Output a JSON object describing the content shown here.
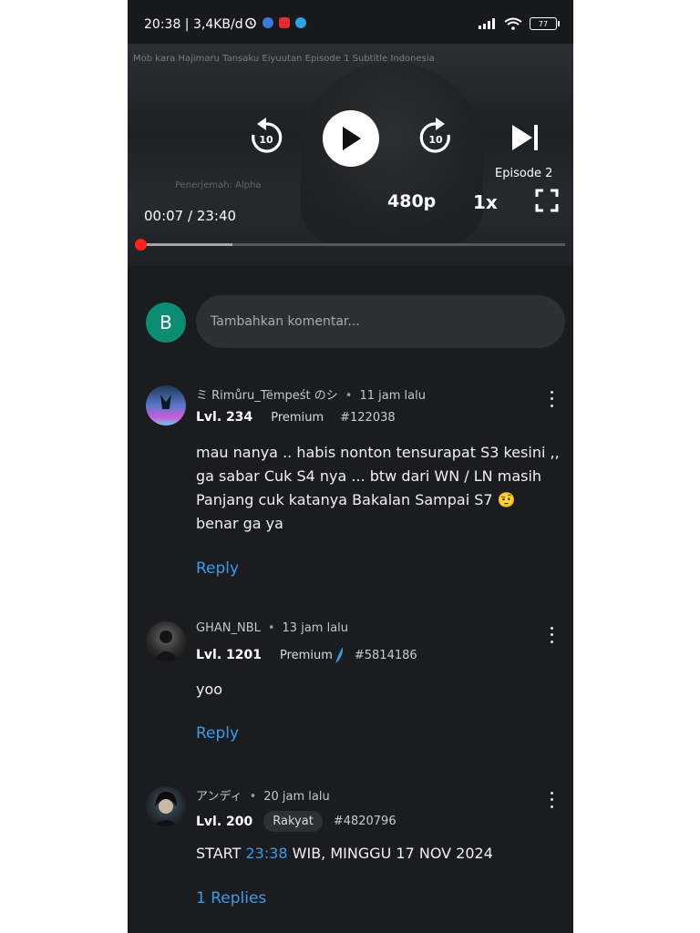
{
  "status_bar": {
    "time": "20:38 | 3,4KB/d",
    "battery": "77"
  },
  "video": {
    "overlay_title": "Mob kara Hajimaru Tansaku Eiyuutan Episode 1 Subtitle Indonesia",
    "watermark": "Penerjemah: Alpha",
    "episode_label": "Episode 2",
    "timecode": "00:07 / 23:40",
    "quality": "480p",
    "speed": "1x",
    "rewind_seconds": "10",
    "forward_seconds": "10",
    "progress_fraction": 0.0049,
    "buffered_fraction": 0.22
  },
  "comment_box": {
    "avatar_letter": "B",
    "placeholder": "Tambahkan komentar..."
  },
  "comments": [
    {
      "username": "ミ Rimůru_Tëmpeśt のシ",
      "time": "11 jam lalu",
      "level": "Lvl. 234",
      "rank": "Premium",
      "id": "#122038",
      "text": "mau nanya .. habis nonton tensurapat S3 kesini ,, ga sabar Cuk S4 nya ... btw dari WN / LN masih Panjang cuk katanya Bakalan Sampai S7 🤨 benar ga ya",
      "action": "Reply"
    },
    {
      "username": "GHAN_NBL",
      "time": "13 jam lalu",
      "level": "Lvl. 1201",
      "rank": "Premium",
      "id": "#5814186",
      "text": "yoo",
      "action": "Reply"
    },
    {
      "username": "アンディ",
      "time": "20 jam lalu",
      "level": "Lvl. 200",
      "rank": "Rakyat",
      "id": "#4820796",
      "text_before": "START ",
      "text_link": "23:38",
      "text_after": " WIB, MINGGU 17 NOV 2024",
      "action": "1 Replies"
    }
  ],
  "colors": {
    "background": "#1b1c20",
    "accent_link": "#3d9be6",
    "progress_thumb": "#ff1f1f",
    "avatar_b": "#0d8c74"
  }
}
